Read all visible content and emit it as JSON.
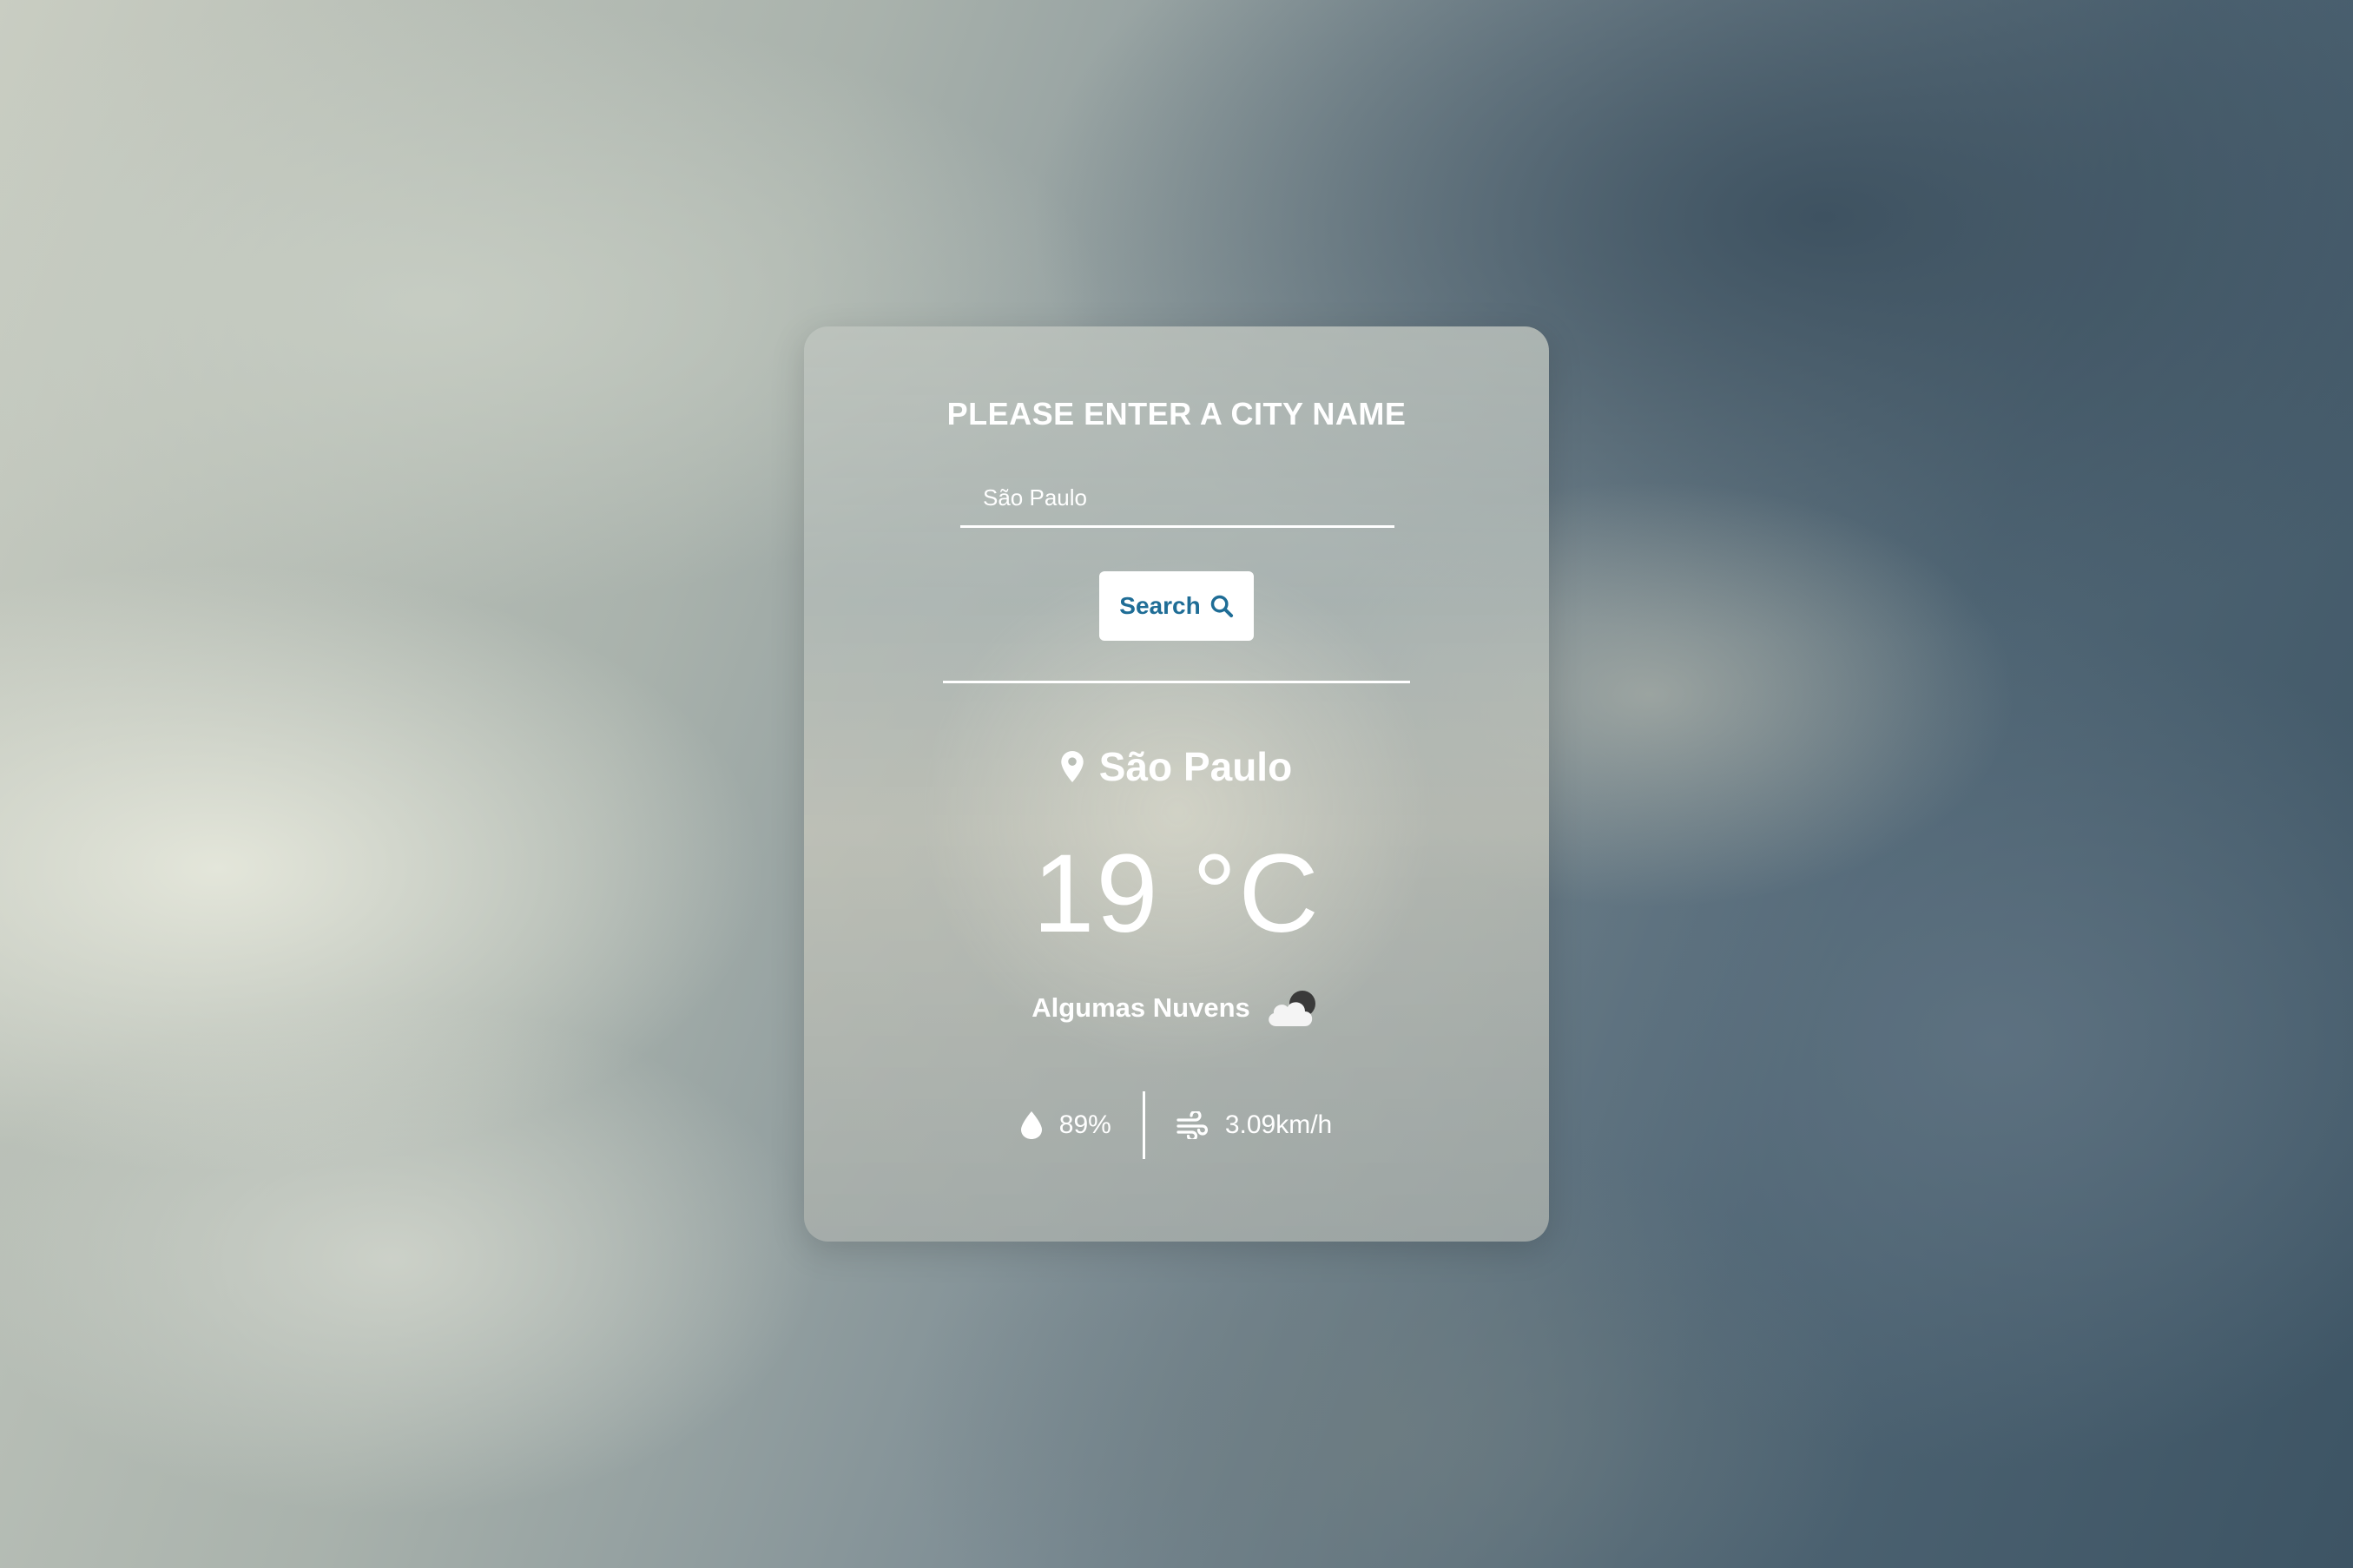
{
  "form": {
    "title": "PLEASE ENTER A CITY NAME",
    "input_value": "São Paulo",
    "search_label": "Search"
  },
  "weather": {
    "city": "São Paulo",
    "temperature": "19 °C",
    "description": "Algumas Nuvens",
    "description_icon": "partly-cloudy-night-icon",
    "humidity": "89%",
    "humidity_icon": "water-drop-icon",
    "wind": "3.09km/h",
    "wind_icon": "wind-icon"
  },
  "colors": {
    "text": "#ffffff",
    "button_text": "#1f6d96",
    "button_bg": "#ffffff"
  }
}
